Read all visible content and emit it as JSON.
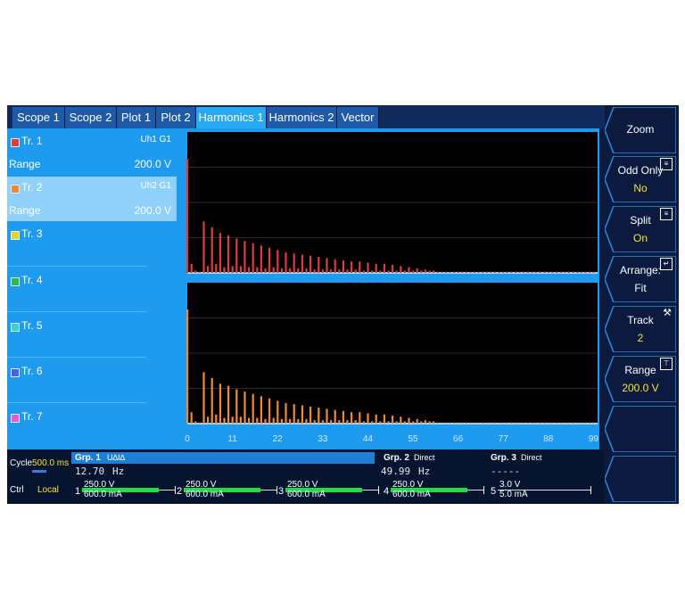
{
  "tabs": [
    "Scope 1",
    "Scope 2",
    "Plot 1",
    "Plot 2",
    "Harmonics 1",
    "Harmonics 2",
    "Vector"
  ],
  "active_tab": "Harmonics 1",
  "traces": [
    {
      "label": "Tr. 1",
      "color": "#e23b3b",
      "signal": "Uh1",
      "group": "G1",
      "range_label": "Range",
      "range": "200.0 V",
      "selected": false
    },
    {
      "label": "Tr. 2",
      "color": "#f08a3a",
      "signal": "Uh2",
      "group": "G1",
      "range_label": "Range",
      "range": "200.0 V",
      "selected": true
    },
    {
      "label": "Tr. 3",
      "color": "#e8d21e"
    },
    {
      "label": "Tr. 4",
      "color": "#2eb84a"
    },
    {
      "label": "Tr. 5",
      "color": "#34d6d0"
    },
    {
      "label": "Tr. 6",
      "color": "#4a5ef0"
    },
    {
      "label": "Tr. 7",
      "color": "#e25ad8"
    }
  ],
  "softkeys": [
    {
      "label": "Zoom",
      "value": "",
      "icon": ""
    },
    {
      "label": "Odd Only",
      "value": "No",
      "icon": "list-icon"
    },
    {
      "label": "Split",
      "value": "On",
      "icon": "list-icon"
    },
    {
      "label": "Arrange:",
      "value": "Fit",
      "icon": "enter-icon"
    },
    {
      "label": "Track",
      "value": "2",
      "icon": "tool-icon"
    },
    {
      "label": "Range",
      "value": "200.0 V",
      "icon": "range-icon"
    },
    {
      "label": "",
      "value": "",
      "icon": ""
    },
    {
      "label": "",
      "value": "",
      "icon": ""
    }
  ],
  "status": {
    "cycle_label": "Cycle",
    "cycle_value": "500.0 ms",
    "ctrl_label": "Ctrl",
    "ctrl_value": "Local",
    "groups": [
      {
        "name": "Grp. 1",
        "mode": "U∆I∆",
        "freq": "12.70",
        "unit": "Hz"
      },
      {
        "name": "Grp. 2",
        "mode": "Direct",
        "freq": "49.99",
        "unit": "Hz"
      },
      {
        "name": "Grp. 3",
        "mode": "Direct",
        "freq": "-----",
        "unit": ""
      }
    ],
    "channels": [
      {
        "num": "1",
        "voltage": "250.0 V",
        "current": "600.0 mA",
        "level": 0.95
      },
      {
        "num": "2",
        "voltage": "250.0 V",
        "current": "600.0 mA",
        "level": 0.95
      },
      {
        "num": "3",
        "voltage": "250.0 V",
        "current": "600.0 mA",
        "level": 0.95
      },
      {
        "num": "4",
        "voltage": "250.0 V",
        "current": "600.0 mA",
        "level": 0.95
      },
      {
        "num": "5",
        "voltage": "3.0 V",
        "current": "5.0 mA",
        "level": 0
      }
    ]
  },
  "chart_data": {
    "type": "bar",
    "x_ticks": [
      "0",
      "11",
      "22",
      "33",
      "44",
      "55",
      "66",
      "77",
      "88",
      "99"
    ],
    "xlim": [
      0,
      100
    ],
    "panels": [
      {
        "trace": "Tr. 1",
        "color": "#e23b3b",
        "values": [
          1.0,
          0.08,
          0.02,
          0.01,
          0.45,
          0.06,
          0.4,
          0.08,
          0.35,
          0.05,
          0.33,
          0.06,
          0.3,
          0.06,
          0.28,
          0.05,
          0.26,
          0.05,
          0.24,
          0.04,
          0.22,
          0.05,
          0.2,
          0.04,
          0.18,
          0.04,
          0.17,
          0.04,
          0.16,
          0.04,
          0.15,
          0.03,
          0.14,
          0.03,
          0.13,
          0.03,
          0.12,
          0.03,
          0.11,
          0.03,
          0.1,
          0.03,
          0.1,
          0.02,
          0.09,
          0.02,
          0.08,
          0.02,
          0.08,
          0.02,
          0.07,
          0.02,
          0.06,
          0.02,
          0.05,
          0.02,
          0.04,
          0.02,
          0.03,
          0.02,
          0.02,
          0.01,
          0.01,
          0.01,
          0.01,
          0.01,
          0.01,
          0.01,
          0.01,
          0.01,
          0.01,
          0.01,
          0.01,
          0.01,
          0.01,
          0.01,
          0.01,
          0.01,
          0.01,
          0.01,
          0.01,
          0.01,
          0.01,
          0.01,
          0.01,
          0.01,
          0.01,
          0.01,
          0.01,
          0.01,
          0.01,
          0.01,
          0.01,
          0.01,
          0.01,
          0.01,
          0.01,
          0.01,
          0.01,
          0.01
        ]
      },
      {
        "trace": "Tr. 2",
        "color": "#f08a3a",
        "values": [
          1.0,
          0.1,
          0.02,
          0.01,
          0.45,
          0.06,
          0.4,
          0.08,
          0.35,
          0.05,
          0.33,
          0.06,
          0.3,
          0.06,
          0.28,
          0.05,
          0.26,
          0.05,
          0.24,
          0.04,
          0.22,
          0.05,
          0.2,
          0.04,
          0.18,
          0.04,
          0.17,
          0.04,
          0.16,
          0.04,
          0.15,
          0.03,
          0.14,
          0.03,
          0.13,
          0.03,
          0.12,
          0.03,
          0.11,
          0.03,
          0.1,
          0.03,
          0.1,
          0.02,
          0.09,
          0.02,
          0.08,
          0.02,
          0.08,
          0.02,
          0.07,
          0.02,
          0.06,
          0.02,
          0.05,
          0.02,
          0.04,
          0.02,
          0.03,
          0.02,
          0.02,
          0.01,
          0.01,
          0.01,
          0.01,
          0.01,
          0.01,
          0.01,
          0.01,
          0.01,
          0.01,
          0.01,
          0.01,
          0.01,
          0.01,
          0.01,
          0.01,
          0.01,
          0.01,
          0.01,
          0.01,
          0.01,
          0.01,
          0.01,
          0.01,
          0.01,
          0.01,
          0.01,
          0.01,
          0.01,
          0.01,
          0.01,
          0.01,
          0.01,
          0.01,
          0.01,
          0.01,
          0.01,
          0.01,
          0.01
        ]
      }
    ]
  }
}
